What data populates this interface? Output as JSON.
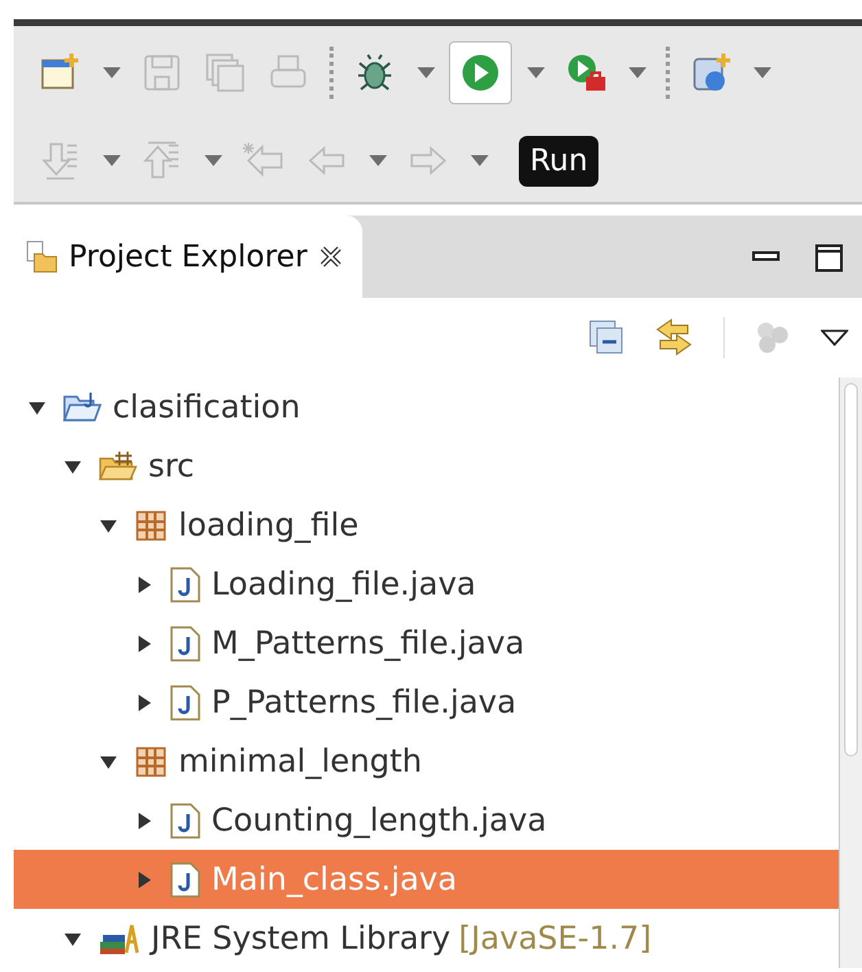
{
  "toolbar_rows": [
    [
      {
        "kind": "new-wizard",
        "disabled": false
      },
      {
        "kind": "dropdown"
      },
      {
        "kind": "save",
        "disabled": true
      },
      {
        "kind": "save-all",
        "disabled": true
      },
      {
        "kind": "print",
        "disabled": true
      },
      {
        "kind": "separator"
      },
      {
        "kind": "debug",
        "disabled": false
      },
      {
        "kind": "dropdown"
      },
      {
        "kind": "run",
        "disabled": false,
        "pressed": true
      },
      {
        "kind": "dropdown"
      },
      {
        "kind": "run-external",
        "disabled": false
      },
      {
        "kind": "dropdown"
      },
      {
        "kind": "separator"
      },
      {
        "kind": "new-server",
        "disabled": false
      },
      {
        "kind": "dropdown"
      }
    ],
    [
      {
        "kind": "next-annotation",
        "disabled": true
      },
      {
        "kind": "dropdown"
      },
      {
        "kind": "prev-annotation",
        "disabled": true
      },
      {
        "kind": "dropdown"
      },
      {
        "kind": "last-edit",
        "disabled": true
      },
      {
        "kind": "back",
        "disabled": true
      },
      {
        "kind": "dropdown"
      },
      {
        "kind": "forward",
        "disabled": true
      },
      {
        "kind": "dropdown"
      }
    ]
  ],
  "tooltip": "Run",
  "view": {
    "title": "Project Explorer"
  },
  "tree": [
    {
      "label": "clasification",
      "kind": "project",
      "expanded": true,
      "selected": false,
      "children": [
        {
          "label": "src",
          "kind": "source-folder",
          "expanded": true,
          "selected": false,
          "children": [
            {
              "label": "loading_file",
              "kind": "package",
              "expanded": true,
              "selected": false,
              "children": [
                {
                  "label": "Loading_file.java",
                  "kind": "java-file",
                  "expanded": false,
                  "selected": false
                },
                {
                  "label": "M_Patterns_file.java",
                  "kind": "java-file",
                  "expanded": false,
                  "selected": false
                },
                {
                  "label": "P_Patterns_file.java",
                  "kind": "java-file",
                  "expanded": false,
                  "selected": false
                }
              ]
            },
            {
              "label": "minimal_length",
              "kind": "package",
              "expanded": true,
              "selected": false,
              "children": [
                {
                  "label": "Counting_length.java",
                  "kind": "java-file",
                  "expanded": false,
                  "selected": false
                },
                {
                  "label": "Main_class.java",
                  "kind": "java-file",
                  "expanded": false,
                  "selected": true
                }
              ]
            }
          ]
        },
        {
          "label": "JRE System Library",
          "decoration": "[JavaSE-1.7]",
          "kind": "library",
          "expanded": true,
          "selected": false
        }
      ]
    }
  ]
}
